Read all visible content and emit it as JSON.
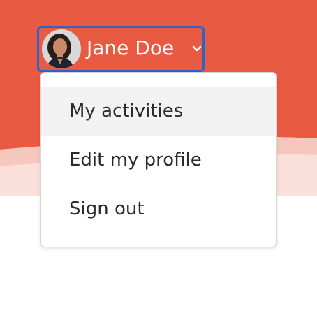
{
  "colors": {
    "header_bg": "#e85a42",
    "wave_light": "#f6c7bd",
    "wave_lighter": "#fbe0da",
    "focus_ring": "#2f63c7",
    "menu_hover_bg": "#f2f2f2",
    "menu_text": "#2b2b2b"
  },
  "user_menu": {
    "name": "Jane Doe",
    "avatar_icon": "user-avatar-photo",
    "toggle_icon": "chevron-down-icon",
    "expanded": true
  },
  "dropdown": {
    "items": [
      {
        "label": "My activities",
        "hovered": true
      },
      {
        "label": "Edit my profile",
        "hovered": false
      },
      {
        "label": "Sign out",
        "hovered": false
      }
    ]
  }
}
